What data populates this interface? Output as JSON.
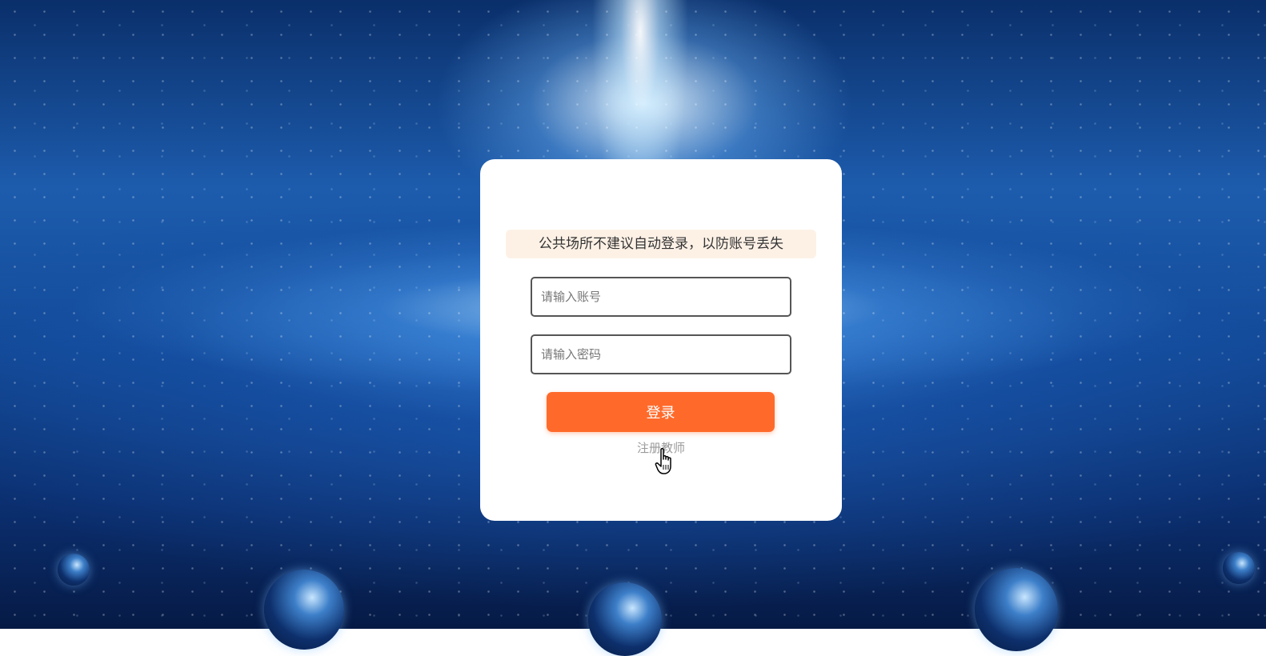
{
  "login": {
    "notice": "公共场所不建议自动登录，以防账号丢失",
    "account_placeholder": "请输入账号",
    "password_placeholder": "请输入密码",
    "login_label": "登录",
    "register_label": "注册教师"
  },
  "colors": {
    "accent": "#ff6a2b",
    "notice_bg": "#fdf1e6",
    "card_bg": "#ffffff"
  },
  "icons": {
    "cursor": "hand-pointer-icon"
  }
}
